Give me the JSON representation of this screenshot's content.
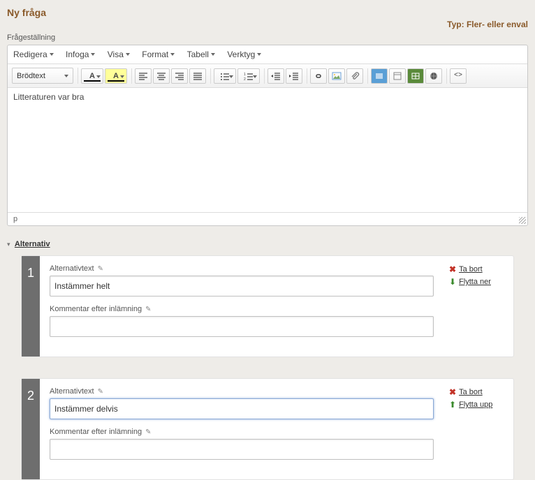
{
  "header": {
    "title": "Ny fråga",
    "type_label": "Typ: Fler- eller enval"
  },
  "question_label": "Frågeställning",
  "editor": {
    "menus": {
      "edit": "Redigera",
      "insert": "Infoga",
      "view": "Visa",
      "format": "Format",
      "table": "Tabell",
      "tools": "Verktyg"
    },
    "block_format": "Brödtext",
    "content": "Litteraturen var bra",
    "status_path": "p"
  },
  "alternatives_section": {
    "title": "Alternativ"
  },
  "alt_labels": {
    "text_label": "Alternativtext",
    "comment_label": "Kommentar efter inlämning",
    "remove": "Ta bort",
    "move_down": "Flytta ner",
    "move_up": "Flytta upp"
  },
  "alternatives": [
    {
      "num": "1",
      "text": "Instämmer helt",
      "comment": "",
      "move": "down"
    },
    {
      "num": "2",
      "text": "Instämmer delvis",
      "comment": "",
      "move": "up"
    }
  ]
}
